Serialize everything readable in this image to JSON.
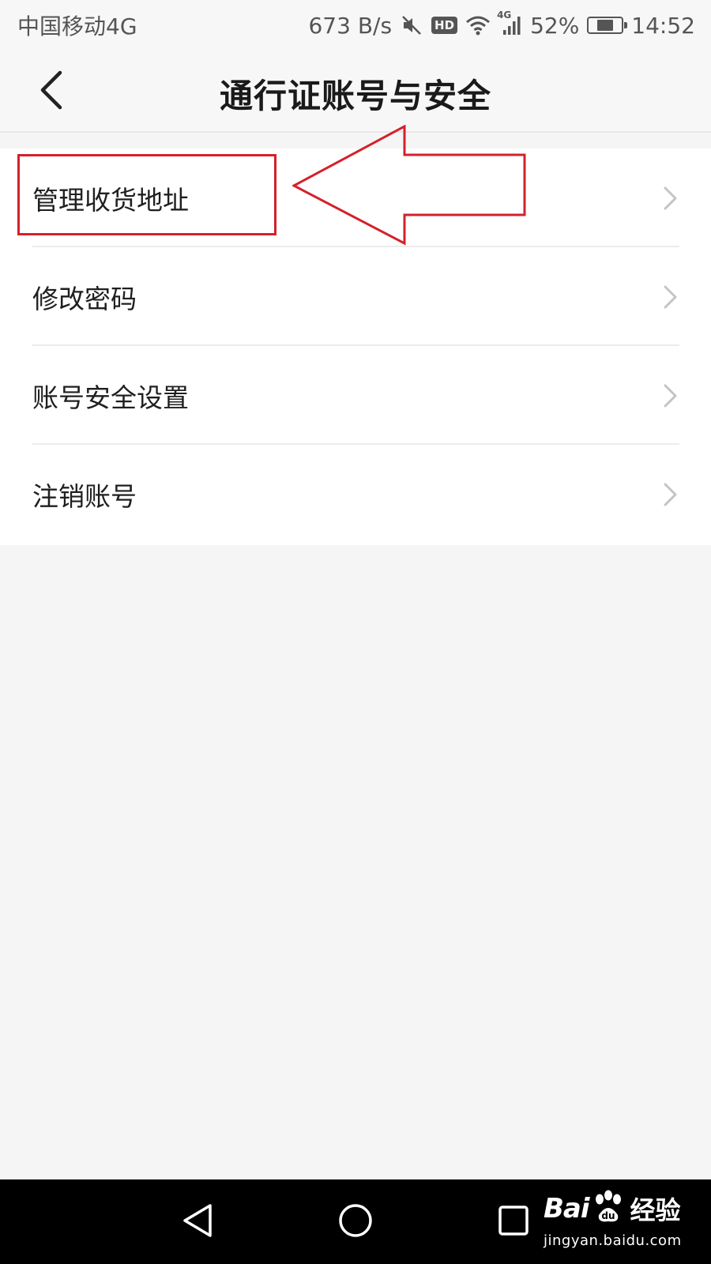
{
  "status_bar": {
    "carrier": "中国移动4G",
    "net_speed": "673 B/s",
    "hd": "HD",
    "network_type": "4G",
    "battery_percent": "52%",
    "battery_level": 0.52,
    "time": "14:52"
  },
  "header": {
    "title": "通行证账号与安全"
  },
  "menu": {
    "items": [
      {
        "label": "管理收货地址"
      },
      {
        "label": "修改密码"
      },
      {
        "label": "账号安全设置"
      },
      {
        "label": "注销账号"
      }
    ]
  },
  "annotation": {
    "color": "#d4202a"
  },
  "watermark": {
    "brand": "Bai",
    "brand_suffix": "经验",
    "url": "jingyan.baidu.com"
  },
  "icons": {
    "back": "chevron-left-icon",
    "chevron": "chevron-right-icon",
    "mute": "mute-icon",
    "wifi": "wifi-icon",
    "signal": "signal-icon",
    "battery": "battery-icon",
    "nav_back": "triangle-back-icon",
    "nav_home": "circle-home-icon",
    "nav_recent": "square-recent-icon",
    "paw": "paw-icon"
  }
}
